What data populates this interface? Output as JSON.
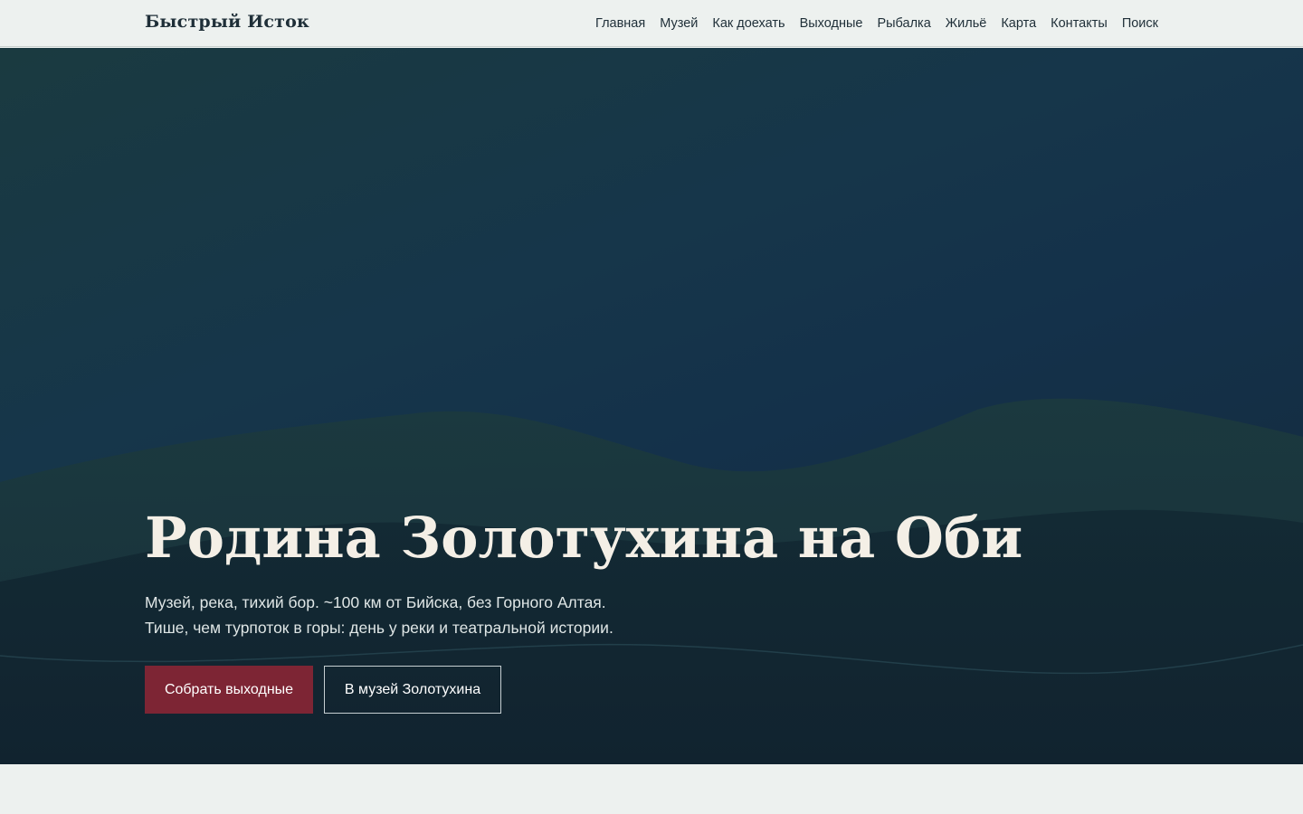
{
  "header": {
    "brand": "Быстрый Исток",
    "nav": [
      {
        "label": "Главная"
      },
      {
        "label": "Музей"
      },
      {
        "label": "Как доехать"
      },
      {
        "label": "Выходные"
      },
      {
        "label": "Рыбалка"
      },
      {
        "label": "Жильё"
      },
      {
        "label": "Карта"
      },
      {
        "label": "Контакты"
      },
      {
        "label": "Поиск"
      }
    ]
  },
  "hero": {
    "title": "Родина Золотухина на Оби",
    "subtitle_lines": [
      "Музей, река, тихий бор. ~100 км от Бийска, без Горного Алтая.",
      "Тише, чем турпоток в горы: день у реки и театральной истории."
    ],
    "primary_button": "Собрать выходные",
    "secondary_button": "В музей Золотухина"
  },
  "colors": {
    "accent": "#7d2534",
    "header_bg": "#edf1ef",
    "hero_bg": "#14314a",
    "text_dark": "#1f2f38"
  }
}
